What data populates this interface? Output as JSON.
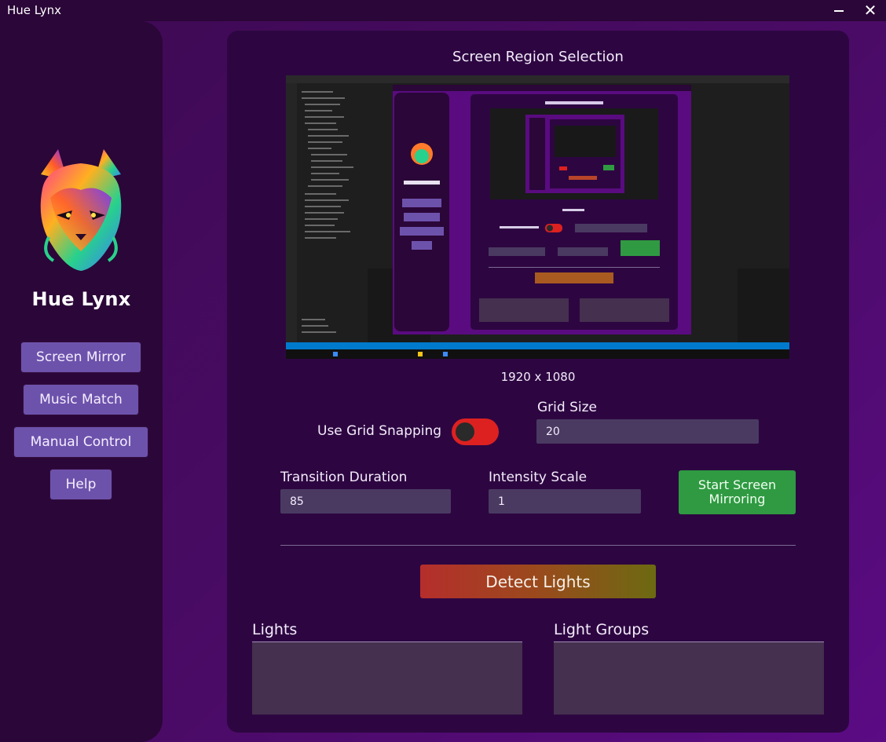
{
  "window": {
    "title": "Hue Lynx"
  },
  "sidebar": {
    "app_name": "Hue Lynx",
    "buttons": [
      "Screen Mirror",
      "Music Match",
      "Manual Control",
      "Help"
    ]
  },
  "main": {
    "section_title": "Screen Region Selection",
    "resolution": "1920 x 1080",
    "grid_snapping_label": "Use Grid Snapping",
    "grid_snapping_on": true,
    "grid_size_label": "Grid Size",
    "grid_size_value": "20",
    "transition_label": "Transition Duration",
    "transition_value": "85",
    "intensity_label": "Intensity Scale",
    "intensity_value": "1",
    "start_button": "Start Screen Mirroring",
    "detect_button": "Detect Lights",
    "lights_title": "Lights",
    "groups_title": "Light Groups"
  },
  "colors": {
    "background": "#4a0b66",
    "panel": "#2d0641",
    "nav_button": "#6d52ac",
    "toggle_on": "#dd2121",
    "start_button": "#2f9a42"
  }
}
